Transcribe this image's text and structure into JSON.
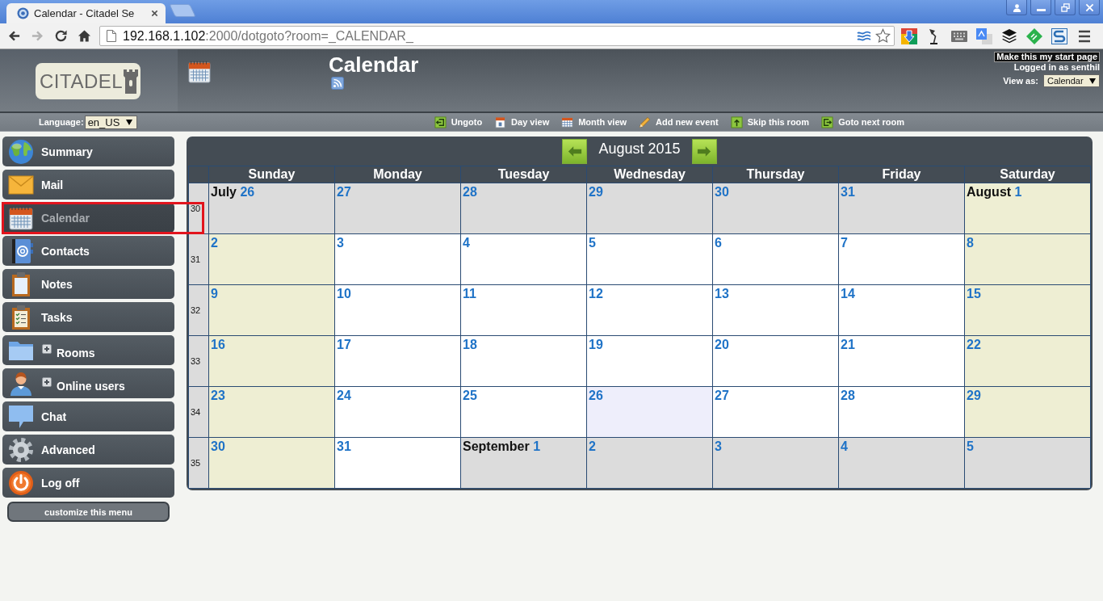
{
  "browser": {
    "tab": {
      "title": "Calendar - Citadel Se"
    },
    "nav_buttons": [
      {
        "disabled": false
      },
      {
        "disabled": true
      },
      {
        "disabled": false
      },
      {
        "disabled": false
      }
    ],
    "address": {
      "host": "192.168.1.102",
      "path": ":2000/dotgoto?room=_CALENDAR_"
    }
  },
  "header": {
    "logo": "CITADEL",
    "title": "Calendar",
    "start_page_link": "Make this my start page",
    "logged_in": "Logged in as senthil",
    "view_as": {
      "label": "View as:",
      "value": "Calendar"
    }
  },
  "action_bar": {
    "language": {
      "label": "Language:",
      "value": "en_US"
    },
    "links": [
      {
        "label": "Ungoto"
      },
      {
        "label": "Day view"
      },
      {
        "label": "Month view"
      },
      {
        "label": "Add new event"
      },
      {
        "label": "Skip this room"
      },
      {
        "label": "Goto next room"
      }
    ]
  },
  "sidebar": {
    "items": [
      {
        "label": "Summary",
        "kind": "link",
        "selected": false,
        "highlighted": false
      },
      {
        "label": "Mail",
        "kind": "link",
        "selected": false,
        "highlighted": false
      },
      {
        "label": "Calendar",
        "kind": "link",
        "selected": true,
        "highlighted": true
      },
      {
        "label": "Contacts",
        "kind": "link",
        "selected": false,
        "highlighted": false
      },
      {
        "label": "Notes",
        "kind": "link",
        "selected": false,
        "highlighted": false
      },
      {
        "label": "Tasks",
        "kind": "link",
        "selected": false,
        "highlighted": false
      },
      {
        "label": "Rooms",
        "kind": "group",
        "expanded": false,
        "selected": false,
        "highlighted": false
      },
      {
        "label": "Online users",
        "kind": "group",
        "expanded": false,
        "selected": false,
        "highlighted": false
      },
      {
        "label": "Chat",
        "kind": "link",
        "selected": false,
        "highlighted": false
      },
      {
        "label": "Advanced",
        "kind": "link",
        "selected": false,
        "highlighted": false
      },
      {
        "label": "Log off",
        "kind": "link",
        "selected": false,
        "highlighted": false
      }
    ],
    "customize": "customize this menu"
  },
  "calendar": {
    "title": "August 2015",
    "weekdays": [
      "Sunday",
      "Monday",
      "Tuesday",
      "Wednesday",
      "Thursday",
      "Friday",
      "Saturday"
    ],
    "weeks": [
      {
        "number": "30",
        "days": [
          {
            "month": "July",
            "day": "26",
            "kind": "other_month"
          },
          {
            "day": "27",
            "kind": "other_month"
          },
          {
            "day": "28",
            "kind": "other_month"
          },
          {
            "day": "29",
            "kind": "other_month"
          },
          {
            "day": "30",
            "kind": "other_month"
          },
          {
            "day": "31",
            "kind": "other_month"
          },
          {
            "month": "August",
            "day": "1",
            "kind": "weekend"
          }
        ]
      },
      {
        "number": "31",
        "days": [
          {
            "day": "2",
            "kind": "weekend"
          },
          {
            "day": "3",
            "kind": "weekday"
          },
          {
            "day": "4",
            "kind": "weekday"
          },
          {
            "day": "5",
            "kind": "weekday"
          },
          {
            "day": "6",
            "kind": "weekday"
          },
          {
            "day": "7",
            "kind": "weekday"
          },
          {
            "day": "8",
            "kind": "weekend"
          }
        ]
      },
      {
        "number": "32",
        "days": [
          {
            "day": "9",
            "kind": "weekend"
          },
          {
            "day": "10",
            "kind": "weekday"
          },
          {
            "day": "11",
            "kind": "weekday"
          },
          {
            "day": "12",
            "kind": "weekday"
          },
          {
            "day": "13",
            "kind": "weekday"
          },
          {
            "day": "14",
            "kind": "weekday"
          },
          {
            "day": "15",
            "kind": "weekend"
          }
        ]
      },
      {
        "number": "33",
        "days": [
          {
            "day": "16",
            "kind": "weekend"
          },
          {
            "day": "17",
            "kind": "weekday"
          },
          {
            "day": "18",
            "kind": "weekday"
          },
          {
            "day": "19",
            "kind": "weekday"
          },
          {
            "day": "20",
            "kind": "weekday"
          },
          {
            "day": "21",
            "kind": "weekday"
          },
          {
            "day": "22",
            "kind": "weekend"
          }
        ]
      },
      {
        "number": "34",
        "days": [
          {
            "day": "23",
            "kind": "weekend"
          },
          {
            "day": "24",
            "kind": "weekday"
          },
          {
            "day": "25",
            "kind": "weekday"
          },
          {
            "day": "26",
            "kind": "today"
          },
          {
            "day": "27",
            "kind": "weekday"
          },
          {
            "day": "28",
            "kind": "weekday"
          },
          {
            "day": "29",
            "kind": "weekend"
          }
        ]
      },
      {
        "number": "35",
        "days": [
          {
            "day": "30",
            "kind": "weekend"
          },
          {
            "day": "31",
            "kind": "weekday"
          },
          {
            "month": "September",
            "day": "1",
            "kind": "other_month"
          },
          {
            "day": "2",
            "kind": "other_month"
          },
          {
            "day": "3",
            "kind": "other_month"
          },
          {
            "day": "4",
            "kind": "other_month"
          },
          {
            "day": "5",
            "kind": "other_month"
          }
        ]
      }
    ]
  }
}
